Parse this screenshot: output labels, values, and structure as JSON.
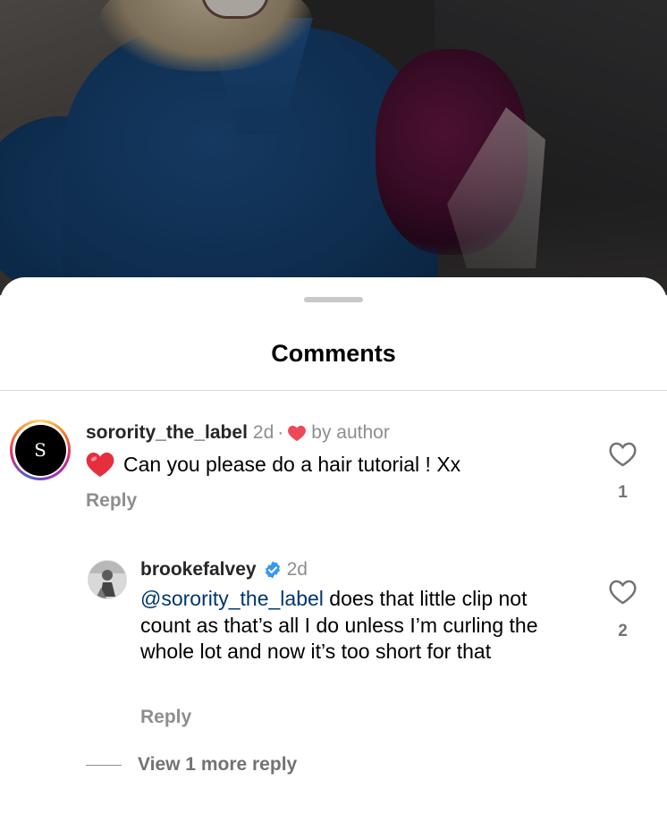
{
  "sheet": {
    "title": "Comments"
  },
  "comments": [
    {
      "username": "sorority_the_label",
      "avatar_letter": "S",
      "time": "2d",
      "separator": "·",
      "liked_by_author_label": "by author",
      "text": "Can you please do a hair tutorial ! Xx",
      "reply_label": "Reply",
      "like_count": "1"
    }
  ],
  "replies": [
    {
      "username": "brookefalvey",
      "verified": true,
      "time": "2d",
      "mention": "@sorority_the_label",
      "text": " does that little clip not count as that’s all I do unless I’m curling the whole lot and now it’s too short for that",
      "reply_label": "Reply",
      "like_count": "2"
    }
  ],
  "view_more_replies": "View 1 more reply",
  "colors": {
    "heart_red": "#ed4956",
    "verified_blue": "#3897f0",
    "mention_blue": "#00376b",
    "muted_text": "#8e8e8e"
  },
  "icons": [
    "heart-outline-icon",
    "heart-filled-icon",
    "verified-badge-icon"
  ]
}
